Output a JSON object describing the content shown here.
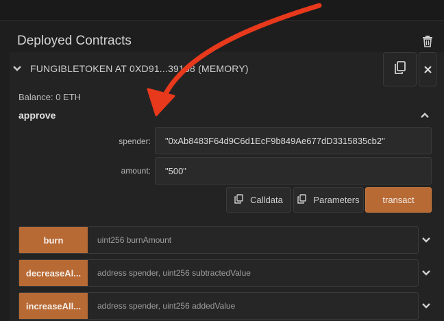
{
  "panel": {
    "title": "Deployed Contracts"
  },
  "contract": {
    "name": "FUNGIBLETOKEN AT 0XD91...39138 (MEMORY)",
    "balance": "Balance: 0 ETH"
  },
  "approve": {
    "name": "approve",
    "params": [
      {
        "label": "spender:",
        "value": "\"0xAb8483F64d9C6d1EcF9b849Ae677dD3315835cb2\""
      },
      {
        "label": "amount:",
        "value": "\"500\""
      }
    ],
    "buttons": {
      "calldata": "Calldata",
      "parameters": "Parameters",
      "transact": "transact"
    }
  },
  "functions": [
    {
      "name": "burn",
      "args": "uint256 burnAmount"
    },
    {
      "name": "decreaseAl...",
      "args": "address spender, uint256 subtractedValue"
    },
    {
      "name": "increaseAll...",
      "args": "address spender, uint256 addedValue"
    }
  ],
  "colors": {
    "accent": "#b86a35",
    "annotation_arrow": "#e8391c",
    "background": "#1e1e1e"
  },
  "icons": {
    "trash": "trash-icon",
    "copy": "copy-icon",
    "close": "close-icon",
    "chevron_down": "chevron-down-icon",
    "chevron_up": "chevron-up-icon"
  }
}
